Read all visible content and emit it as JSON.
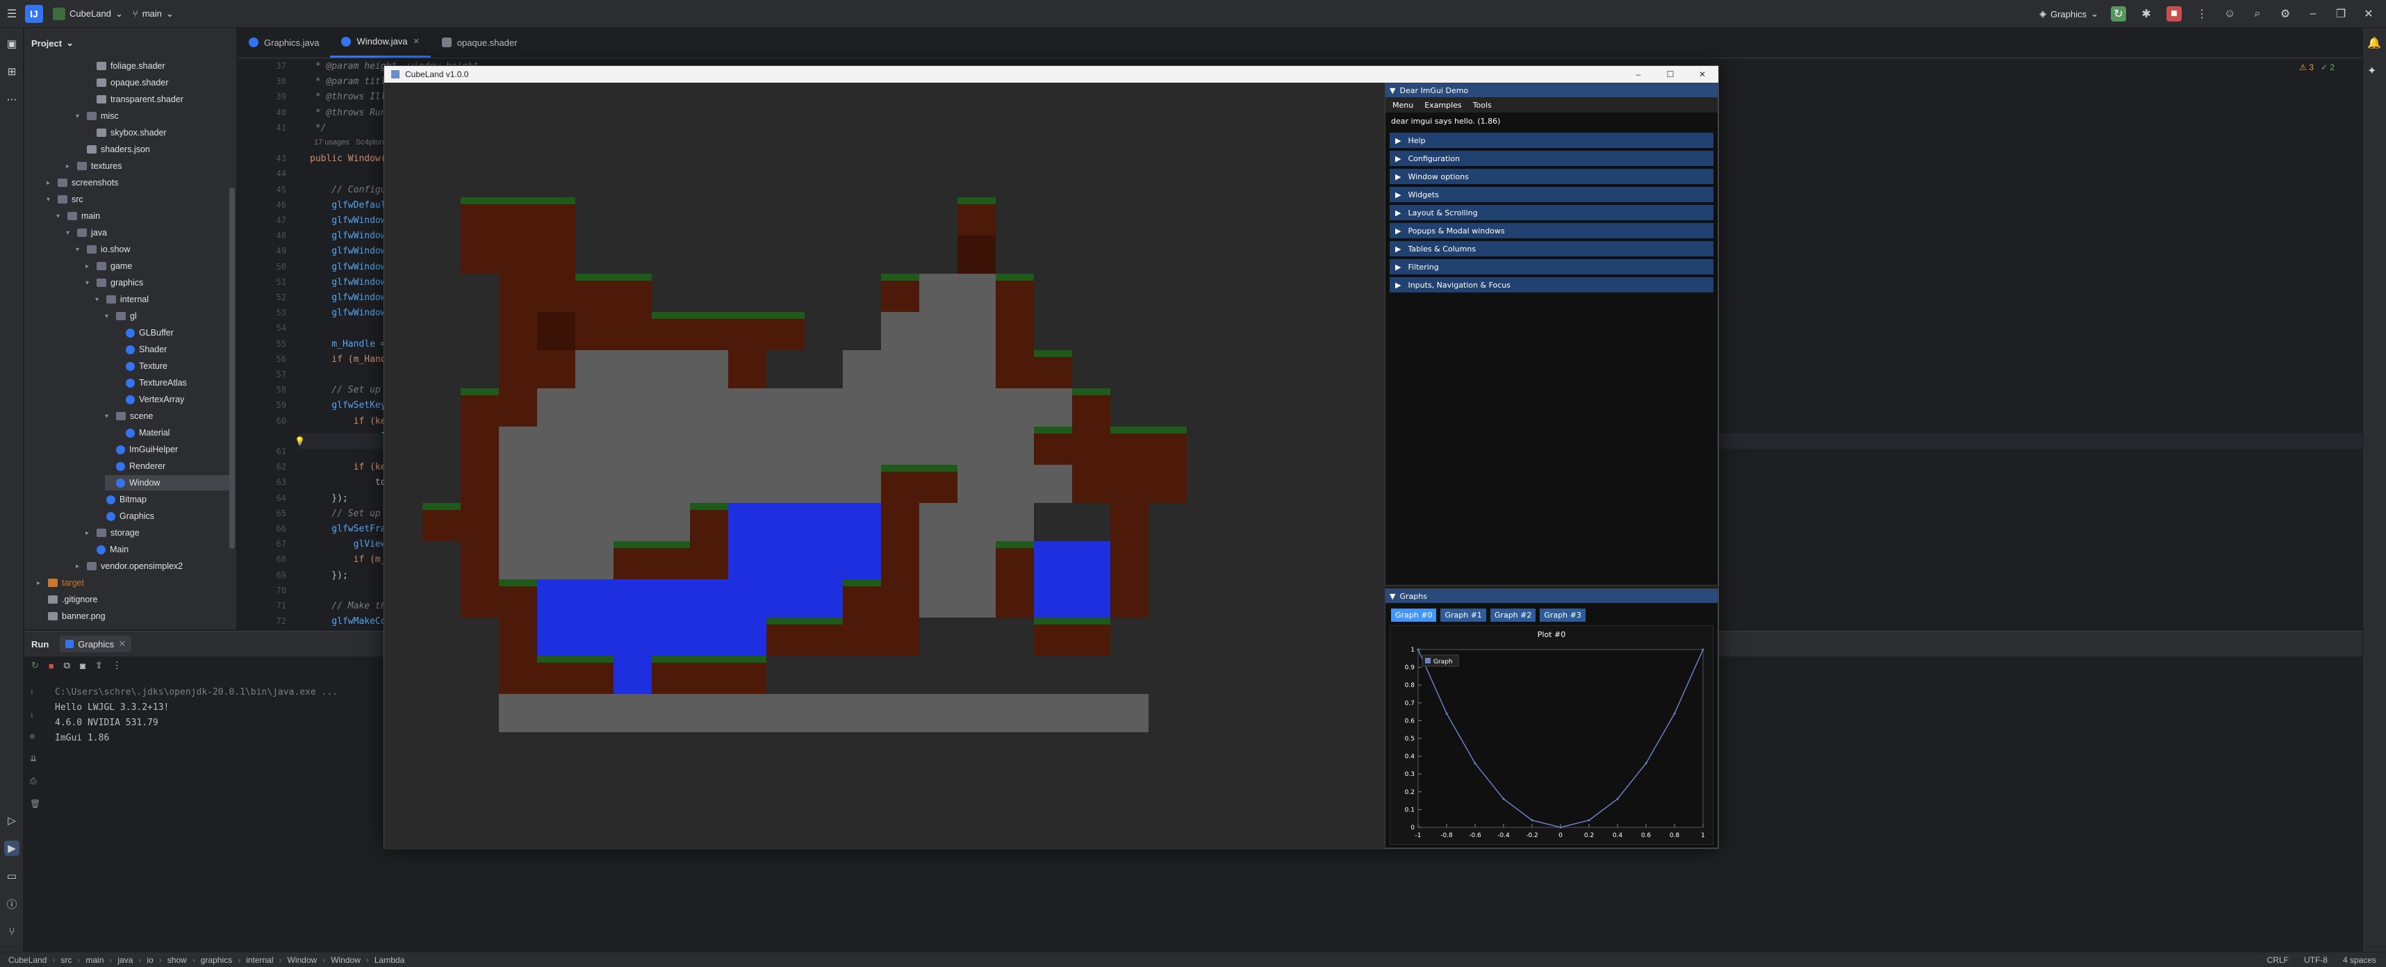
{
  "titlebar": {
    "project": "CubeLand",
    "branch": "main",
    "run_config": "Graphics"
  },
  "project_panel": {
    "title": "Project",
    "rows": [
      {
        "label": "foliage.shader",
        "indent": 7,
        "kind": "file"
      },
      {
        "label": "opaque.shader",
        "indent": 7,
        "kind": "file"
      },
      {
        "label": "transparent.shader",
        "indent": 7,
        "kind": "file"
      },
      {
        "label": "misc",
        "indent": 6,
        "kind": "folder",
        "arrow": "▾"
      },
      {
        "label": "skybox.shader",
        "indent": 7,
        "kind": "file"
      },
      {
        "label": "shaders.json",
        "indent": 6,
        "kind": "file"
      },
      {
        "label": "textures",
        "indent": 5,
        "kind": "folder",
        "arrow": "▸"
      },
      {
        "label": "screenshots",
        "indent": 3,
        "kind": "folder",
        "arrow": "▸"
      },
      {
        "label": "src",
        "indent": 3,
        "kind": "folder",
        "arrow": "▾"
      },
      {
        "label": "main",
        "indent": 4,
        "kind": "folder",
        "arrow": "▾"
      },
      {
        "label": "java",
        "indent": 5,
        "kind": "folder",
        "arrow": "▾"
      },
      {
        "label": "io.show",
        "indent": 6,
        "kind": "folder",
        "arrow": "▾"
      },
      {
        "label": "game",
        "indent": 7,
        "kind": "folder",
        "arrow": "▸"
      },
      {
        "label": "graphics",
        "indent": 7,
        "kind": "folder",
        "arrow": "▾"
      },
      {
        "label": "internal",
        "indent": 8,
        "kind": "folder",
        "arrow": "▾"
      },
      {
        "label": "gl",
        "indent": 9,
        "kind": "folder",
        "arrow": "▾"
      },
      {
        "label": "GLBuffer",
        "indent": 10,
        "kind": "class"
      },
      {
        "label": "Shader",
        "indent": 10,
        "kind": "class"
      },
      {
        "label": "Texture",
        "indent": 10,
        "kind": "class"
      },
      {
        "label": "TextureAtlas",
        "indent": 10,
        "kind": "class"
      },
      {
        "label": "VertexArray",
        "indent": 10,
        "kind": "class"
      },
      {
        "label": "scene",
        "indent": 9,
        "kind": "folder",
        "arrow": "▾"
      },
      {
        "label": "Material",
        "indent": 10,
        "kind": "class"
      },
      {
        "label": "ImGuiHelper",
        "indent": 9,
        "kind": "class"
      },
      {
        "label": "Renderer",
        "indent": 9,
        "kind": "class"
      },
      {
        "label": "Window",
        "indent": 9,
        "kind": "class",
        "selected": true
      },
      {
        "label": "Bitmap",
        "indent": 8,
        "kind": "class"
      },
      {
        "label": "Graphics",
        "indent": 8,
        "kind": "class"
      },
      {
        "label": "storage",
        "indent": 7,
        "kind": "folder",
        "arrow": "▸"
      },
      {
        "label": "Main",
        "indent": 7,
        "kind": "class"
      },
      {
        "label": "vendor.opensimplex2",
        "indent": 6,
        "kind": "folder",
        "arrow": "▸"
      },
      {
        "label": "target",
        "indent": 2,
        "kind": "target",
        "arrow": "▸"
      },
      {
        "label": ".gitignore",
        "indent": 2,
        "kind": "file"
      },
      {
        "label": "banner.png",
        "indent": 2,
        "kind": "file"
      }
    ]
  },
  "editor_tabs": [
    {
      "label": "Graphics.java",
      "icon": "java-class-icon",
      "active": false
    },
    {
      "label": "Window.java",
      "icon": "java-class-icon",
      "active": true
    },
    {
      "label": "opaque.shader",
      "icon": "shader-file-icon",
      "active": false
    }
  ],
  "editor": {
    "warnings": "⚠ 3",
    "checks": "✓ 2",
    "lines": [
      {
        "n": "37",
        "t": " * @param height  window height"
      },
      {
        "n": "38",
        "t": " * @param title   title of the window"
      },
      {
        "n": "39",
        "t": " * @throws IllegalStateException failed to initialize GLFW"
      },
      {
        "n": "40",
        "t": " * @throws RuntimeException       failed to create the GLFW window object"
      },
      {
        "n": "41",
        "t": " */"
      },
      {
        "n": "",
        "t": "17 usages   Sc4pton25"
      },
      {
        "n": "43",
        "t": "public Window(int width, int height, CharSequence title) {"
      },
      {
        "n": "44",
        "t": ""
      },
      {
        "n": "45",
        "t": "    // Configure GLFW"
      },
      {
        "n": "46",
        "t": "    glfwDefaultWindowHints(); // optional, the current window hints are already the default"
      },
      {
        "n": "47",
        "t": "    glfwWindowHint(GLFW_VISIBLE, GLFW_FALSE); // the window will stay hidden after creation"
      },
      {
        "n": "48",
        "t": "    glfwWindowHint(GLFW_RESIZABLE, GLFW_TRUE); // the window will be resizable"
      },
      {
        "n": "49",
        "t": "    glfwWindowHint(GLFW_MAXIMIZED, GLFW_TRUE); // make the window maximized on startup"
      },
      {
        "n": "50",
        "t": "    glfwWindowHint(GLFW_CONTEXT_VERSION_MAJOR, 4); // set the opengl context"
      },
      {
        "n": "51",
        "t": "    glfwWindowHint(GLFW_CONTEXT_VERSION_MINOR, 6); // version to 4.6.0"
      },
      {
        "n": "52",
        "t": "    glfwWindowHint(GLFW_OPENGL_PROFILE, GLFW_OPENGL_CORE_PROFILE); // set profile to core"
      },
      {
        "n": "53",
        "t": "    glfwWindowHint(GLFW_TRANSPARENT_FRAMEBUFFER, GLFW_TRUE); // just make the window background transparent... :)"
      },
      {
        "n": "54",
        "t": ""
      },
      {
        "n": "55",
        "t": "    m_Handle = glfwCreateWindow(width, height, title, NULL, NULL);"
      },
      {
        "n": "56",
        "t": "    if (m_Handle == NULL) throw new RuntimeException(\"Failed to create the GLFW window\");"
      },
      {
        "n": "57",
        "t": ""
      },
      {
        "n": "58",
        "t": "    // Set up a key callback. It will be called every time a key is pressed, repeated or released."
      },
      {
        "n": "59",
        "t": "    glfwSetKeyCallback(m_Handle, (window, key, scancode, action, mods) -> {"
      },
      {
        "n": "60",
        "t": "        if (key == GLFW_KEY_ESCAPE && action == GLFW_RELEASE)"
      },
      {
        "n": "",
        "t": "            glfwSetWindowShouldClose(window, true); // We will detect this in the rendering loop"
      },
      {
        "n": "61",
        "t": ""
      },
      {
        "n": "62",
        "t": "        if (key == GLFW_KEY_F11 && action == GLFW_PRESS)"
      },
      {
        "n": "63",
        "t": "            toggleFullscreenMode(); // toggle fullscreen / if (action == GLFW_PRESS); // toggle fullscreen"
      },
      {
        "n": "64",
        "t": "    });"
      },
      {
        "n": "65",
        "t": "    // Set up a framebuffer size callback"
      },
      {
        "n": "66",
        "t": "    glfwSetFramebufferSizeCallback(m_Handle, (window, w, h) -> {"
      },
      {
        "n": "67",
        "t": "        glViewport(0, 0, w, h);"
      },
      {
        "n": "68",
        "t": "        if (m_Resized != null) m_Resized.run();"
      },
      {
        "n": "69",
        "t": "    });"
      },
      {
        "n": "70",
        "t": ""
      },
      {
        "n": "71",
        "t": "    // Make the OpenGL context current"
      },
      {
        "n": "72",
        "t": "    glfwMakeContextCurrent(m_Handle);"
      }
    ]
  },
  "run_panel": {
    "label": "Run",
    "tab": "Graphics",
    "console": [
      "C:\\Users\\schre\\.jdks\\openjdk-20.0.1\\bin\\java.exe ...",
      "Hello LWJGL 3.3.2+13!",
      "4.6.0 NVIDIA 531.79",
      "ImGui 1.86"
    ]
  },
  "app_window": {
    "title": "CubeLand v1.0.0"
  },
  "imgui_demo": {
    "title": "Dear ImGui Demo",
    "menu": [
      "Menu",
      "Examples",
      "Tools"
    ],
    "greeting": "dear imgui says hello. (1.86)",
    "headers": [
      "Help",
      "Configuration",
      "Window options",
      "Widgets",
      "Layout & Scrolling",
      "Popups & Modal windows",
      "Tables & Columns",
      "Filtering",
      "Inputs, Navigation & Focus"
    ]
  },
  "imgui_graphs": {
    "title": "Graphs",
    "tabs": [
      "Graph #0",
      "Graph #1",
      "Graph #2",
      "Graph #3"
    ],
    "active_tab": 0,
    "plot_title": "Plot #0",
    "legend": "Graph"
  },
  "chart_data": {
    "type": "line",
    "title": "Plot #0",
    "series": [
      {
        "name": "Graph",
        "x": [
          -1,
          -0.8,
          -0.6,
          -0.4,
          -0.2,
          0,
          0.2,
          0.4,
          0.6,
          0.8,
          1
        ],
        "values": [
          1,
          0.64,
          0.36,
          0.16,
          0.04,
          0,
          0.04,
          0.16,
          0.36,
          0.64,
          1
        ]
      }
    ],
    "x_ticks": [
      "-1",
      "-0.8",
      "-0.6",
      "-0.4",
      "-0.2",
      "0",
      "0.2",
      "0.4",
      "0.6",
      "0.8",
      "1"
    ],
    "y_ticks": [
      "1",
      "0.9",
      "0.8",
      "0.7",
      "0.6",
      "0.5",
      "0.4",
      "0.3",
      "0.2",
      "0.1",
      "0"
    ],
    "xlim": [
      -1,
      1
    ],
    "ylim": [
      0,
      1
    ],
    "line_color": "#6b7fc4"
  },
  "statusbar": {
    "breadcrumbs": [
      "CubeLand",
      "src",
      "main",
      "java",
      "io",
      "show",
      "graphics",
      "internal",
      "Window",
      "Window",
      "Lambda"
    ],
    "line_ending": "CRLF",
    "encoding": "UTF-8",
    "indent": "4 spaces"
  },
  "colors": {
    "accent": "#3574f0",
    "run_green": "#57965c",
    "stop_red": "#c94f4f",
    "imgui_header": "#214170"
  }
}
